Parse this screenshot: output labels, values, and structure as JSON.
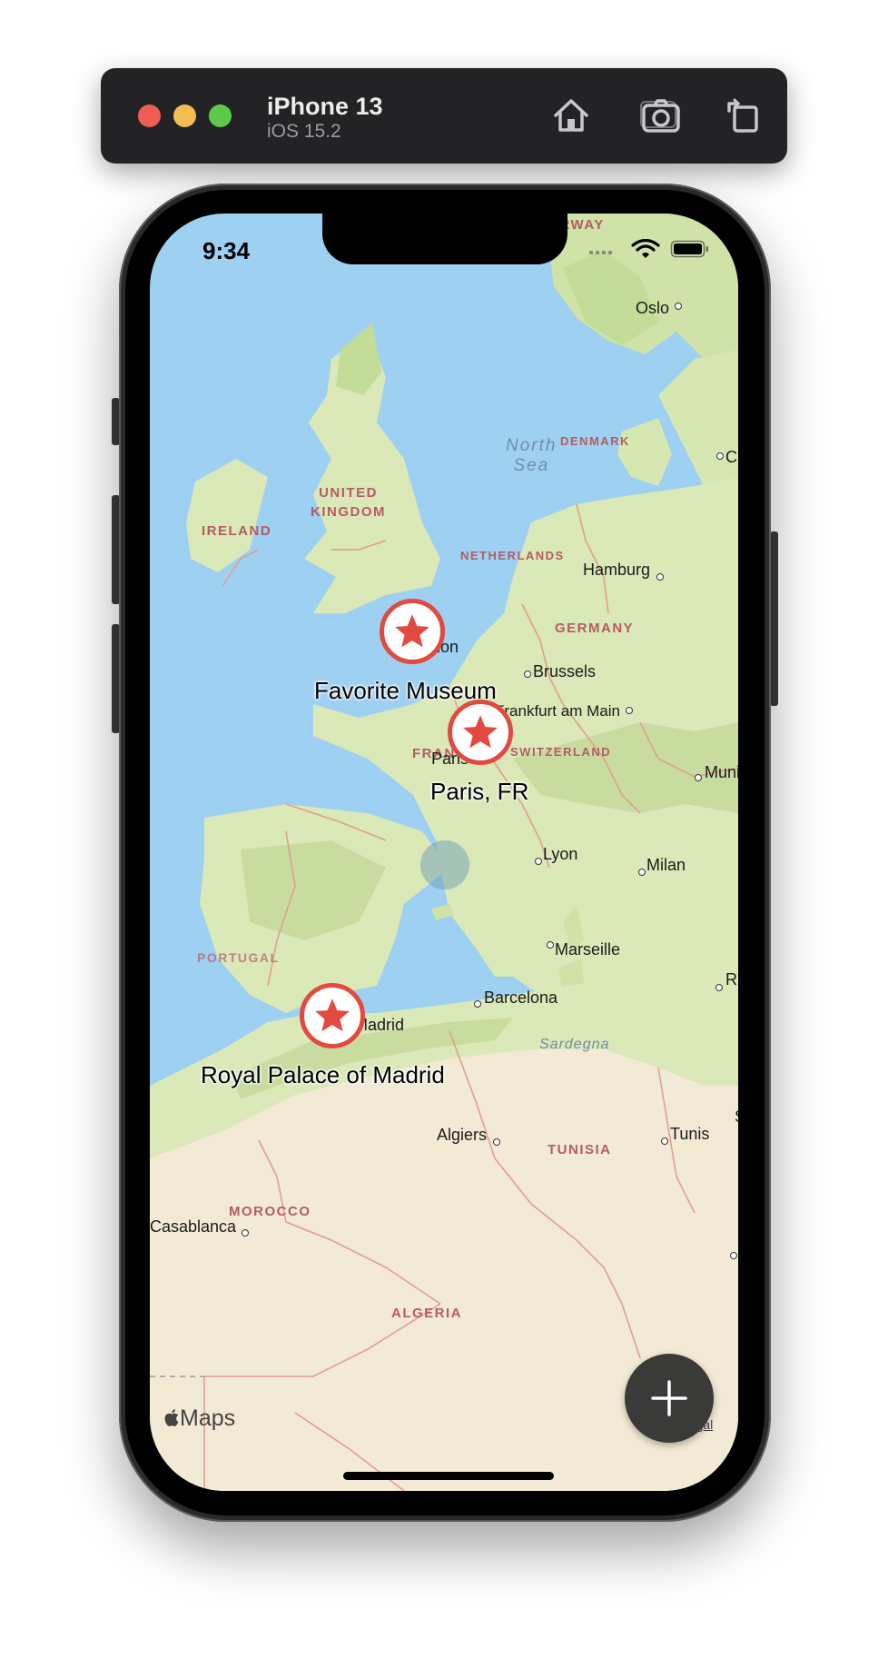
{
  "simulator": {
    "device_name": "iPhone 13",
    "os_version": "iOS 15.2",
    "buttons": [
      "home-icon",
      "screenshot-icon",
      "rotate-icon"
    ]
  },
  "status_bar": {
    "time": "9:34",
    "icons": [
      "cellular-icon",
      "wifi-icon",
      "battery-icon"
    ]
  },
  "map": {
    "countries": [
      "NORWAY",
      "DENMARK",
      "UNITED\nKINGDOM",
      "IRELAND",
      "NETHERLANDS",
      "GERMANY",
      "FRANCE",
      "SWITZERLAND",
      "PORTUGAL",
      "MOROCCO",
      "ALGERIA",
      "TUNISIA"
    ],
    "seas": [
      "North\nSea",
      "Sardegna"
    ],
    "cities": [
      "Oslo",
      "C",
      "Hamburg",
      "London",
      "Brussels",
      "Frankfurt am Main",
      "Paris",
      "Muni",
      "Lyon",
      "Milan",
      "Marseille",
      "Barcelona",
      "Madrid",
      "R",
      "Algiers",
      "Tunis",
      "Casablanca",
      "S"
    ],
    "pins": [
      {
        "title": "Favorite Museum",
        "icon": "star-icon"
      },
      {
        "title": "Paris, FR",
        "icon": "star-icon"
      },
      {
        "title": "Royal Palace of Madrid",
        "icon": "star-icon"
      }
    ],
    "attribution": "Maps",
    "legal": "Legal"
  },
  "fab": {
    "icon": "plus-icon"
  },
  "colors": {
    "water": "#9ed0f2",
    "land": "#dbe8b8",
    "desert": "#f2ead4",
    "border": "#e29e93",
    "pin_red": "#e34a3f",
    "country_label": "#b35d63",
    "fab": "#3a3a38"
  }
}
